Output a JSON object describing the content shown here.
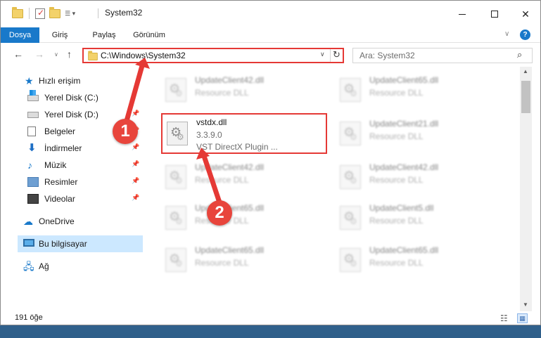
{
  "window": {
    "title": "System32",
    "controls": {
      "minimize": "—",
      "maximize": "☐",
      "close": "✕"
    }
  },
  "ribbon": {
    "tabs": [
      "Dosya",
      "Giriş",
      "Paylaş",
      "Görünüm"
    ],
    "help": "?"
  },
  "nav": {
    "back": "←",
    "forward": "→",
    "up": "↑",
    "recent": "∨",
    "address": "C:\\Windows\\System32",
    "address_dropdown": "∨",
    "refresh": "↻",
    "search_placeholder": "Ara: System32"
  },
  "sidebar": {
    "quick_access": "Hızlı erişim",
    "items": [
      {
        "label": "Yerel Disk (C:)",
        "icon": "drive-windows-icon",
        "pinned": false
      },
      {
        "label": "Yerel Disk (D:)",
        "icon": "drive-icon",
        "pinned": true
      },
      {
        "label": "Belgeler",
        "icon": "documents-icon",
        "pinned": true
      },
      {
        "label": "İndirmeler",
        "icon": "downloads-icon",
        "pinned": true
      },
      {
        "label": "Müzik",
        "icon": "music-icon",
        "pinned": true
      },
      {
        "label": "Resimler",
        "icon": "pictures-icon",
        "pinned": true
      },
      {
        "label": "Videolar",
        "icon": "videos-icon",
        "pinned": true
      }
    ],
    "onedrive": "OneDrive",
    "this_pc": "Bu bilgisayar",
    "network": "Ağ"
  },
  "files": {
    "tiles": [
      {
        "name": "UpdateClient42.dll",
        "desc": "Resource DLL"
      },
      {
        "name": "UpdateClient65.dll",
        "desc": "Resource DLL"
      },
      {
        "name": "UpdateClient21.dll",
        "desc": "Resource DLL"
      },
      {
        "name": "UpdateClient42.dll",
        "desc": "Resource DLL"
      },
      {
        "name": "UpdateClient42.dll",
        "desc": "Resource DLL"
      },
      {
        "name": "UpdateClient65.dll",
        "desc": "Resource DLL"
      },
      {
        "name": "UpdateClient5.dll",
        "desc": "Resource DLL"
      },
      {
        "name": "UpdateClient65.dll",
        "desc": "Resource DLL"
      },
      {
        "name": "UpdateClient65.dll",
        "desc": "Resource DLL"
      }
    ],
    "highlighted": {
      "name": "vstdx.dll",
      "version": "3.3.9.0",
      "desc": "VST DirectX Plugin ..."
    }
  },
  "status": {
    "count": "191 öğe"
  },
  "annotations": {
    "step1": "1",
    "step2": "2",
    "color": "#e53935"
  }
}
